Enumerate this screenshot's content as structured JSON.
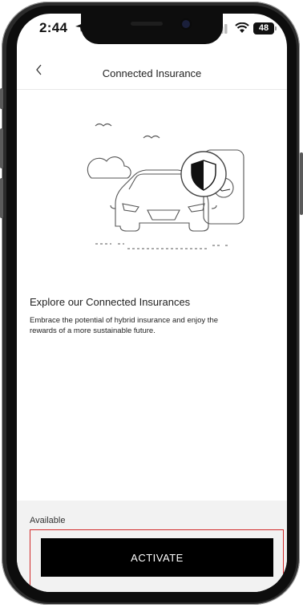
{
  "status_bar": {
    "time": "2:44",
    "battery": "48"
  },
  "header": {
    "title": "Connected Insurance"
  },
  "content": {
    "heading": "Explore our Connected Insurances",
    "description": "Embrace the potential of hybrid insurance and enjoy the rewards of a more sustainable future."
  },
  "footer": {
    "status_label": "Available",
    "activate_label": "ACTIVATE"
  },
  "colors": {
    "button_bg": "#000000",
    "highlight": "#d12b2b",
    "footer_bg": "#f2f2f2"
  }
}
